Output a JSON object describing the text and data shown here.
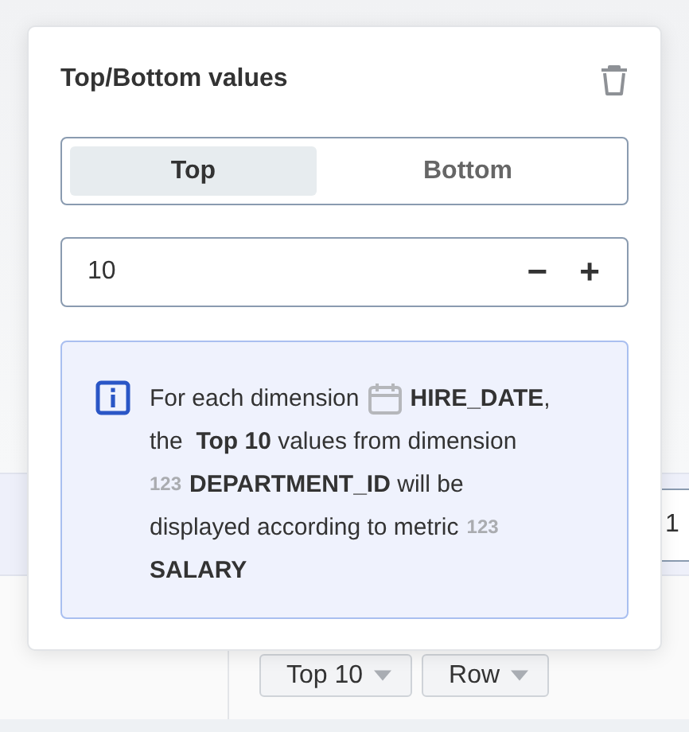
{
  "background": {
    "row_field_value": "1",
    "toolbar": [
      {
        "label": "Top 10"
      },
      {
        "label": "Row"
      }
    ]
  },
  "popup": {
    "title": "Top/Bottom values",
    "segments": [
      {
        "label": "Top",
        "selected": true
      },
      {
        "label": "Bottom",
        "selected": false
      }
    ],
    "count": {
      "value": "10",
      "decrement": "−",
      "increment": "+"
    },
    "info": [
      [
        {
          "kind": "text",
          "text": "For each dimension"
        },
        {
          "kind": "calendar"
        },
        {
          "kind": "text",
          "text": "**HIRE_DATE**,"
        }
      ],
      [
        {
          "kind": "text",
          "text": "the  **Top 10** values from dimension"
        }
      ],
      [
        {
          "kind": "type",
          "text": "123"
        },
        {
          "kind": "text",
          "text": "**DEPARTMENT_ID** will be"
        }
      ],
      [
        {
          "kind": "text",
          "text": "displayed according to metric"
        },
        {
          "kind": "type",
          "text": "123"
        }
      ],
      [
        {
          "kind": "text",
          "text": "**SALARY**"
        }
      ]
    ]
  }
}
